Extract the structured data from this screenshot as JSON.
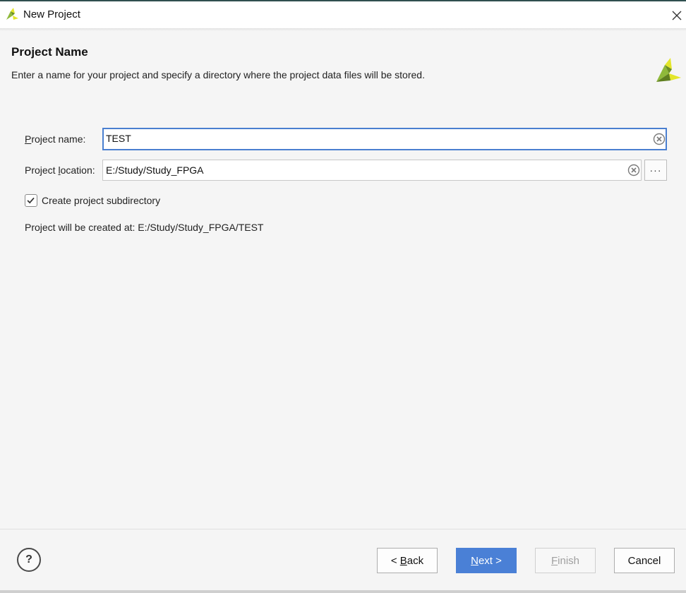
{
  "window": {
    "title": "New Project",
    "app_icon": "xilinx-logo-icon",
    "close_icon": "close-icon"
  },
  "page": {
    "heading": "Project Name",
    "subtitle": "Enter a name for your project and specify a directory where the project data files will be stored.",
    "brand_icon": "vivado-logo-icon"
  },
  "form": {
    "project_name": {
      "label_mnemonic": "P",
      "label_rest": "roject name:",
      "value": "TEST"
    },
    "project_location": {
      "label_pre": "Project ",
      "label_mnemonic": "l",
      "label_rest": "ocation:",
      "value": "E:/Study/Study_FPGA",
      "browse_label": "···"
    },
    "create_subdirectory": {
      "checked": true,
      "label": "Create project subdirectory"
    },
    "info": "Project will be created at: E:/Study/Study_FPGA/TEST"
  },
  "footer": {
    "help_label": "?",
    "back": {
      "prefix": "< ",
      "mnemonic": "B",
      "rest": "ack"
    },
    "next": {
      "mnemonic": "N",
      "rest": "ext >"
    },
    "finish": {
      "mnemonic": "F",
      "rest": "inish",
      "enabled": false
    },
    "cancel": "Cancel"
  },
  "colors": {
    "accent": "#4a80d6",
    "focus_border": "#4a7fd0",
    "logo_green": "#8fb93a",
    "logo_yellow": "#e3e62a"
  }
}
